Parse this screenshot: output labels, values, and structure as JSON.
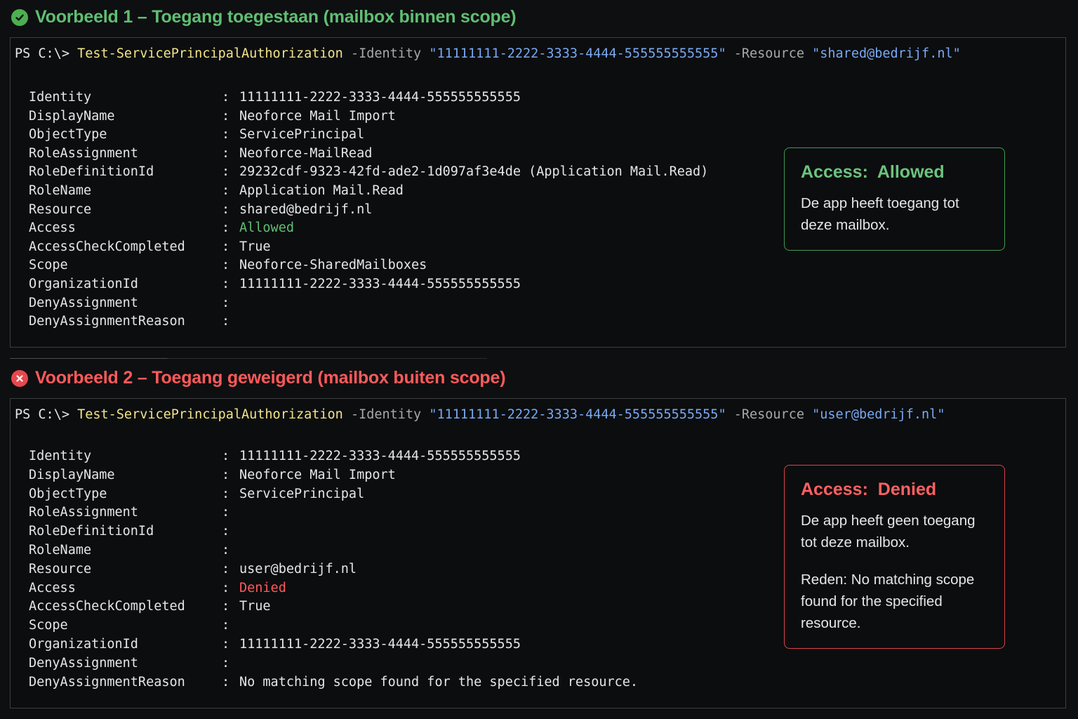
{
  "colors": {
    "success": "#5fbf73",
    "error": "#ff5a5a",
    "cmdlet": "#f1e38a",
    "string": "#79a9f2",
    "background": "#0e0f11"
  },
  "example1": {
    "title": "Voorbeeld 1 – Toegang toegestaan (mailbox binnen scope)",
    "icon": "check-circle-icon",
    "command": {
      "prompt": "PS C:\\>",
      "cmdlet": "Test-ServicePrincipalAuthorization",
      "identity_param": "-Identity",
      "identity_value": "\"11111111-2222-3333-4444-555555555555\"",
      "resource_param": "-Resource",
      "resource_value": "\"shared@bedrijf.nl\""
    },
    "props": [
      {
        "key": "Identity",
        "value": "11111111-2222-3333-4444-555555555555"
      },
      {
        "key": "DisplayName",
        "value": "Neoforce Mail Import"
      },
      {
        "key": "ObjectType",
        "value": "ServicePrincipal"
      },
      {
        "key": "RoleAssignment",
        "value": "Neoforce-MailRead"
      },
      {
        "key": "RoleDefinitionId",
        "value": "29232cdf-9323-42fd-ade2-1d097af3e4de (Application Mail.Read)"
      },
      {
        "key": "RoleName",
        "value": "Application Mail.Read"
      },
      {
        "key": "Resource",
        "value": "shared@bedrijf.nl"
      },
      {
        "key": "Access",
        "value": "Allowed"
      },
      {
        "key": "AccessCheckCompleted",
        "value": "True"
      },
      {
        "key": "Scope",
        "value": "Neoforce-SharedMailboxes"
      },
      {
        "key": "OrganizationId",
        "value": "11111111-2222-3333-4444-555555555555"
      },
      {
        "key": "DenyAssignment",
        "value": ""
      },
      {
        "key": "DenyAssignmentReason",
        "value": ""
      }
    ],
    "callout": {
      "title": "Access:  Allowed",
      "text": "De app heeft toegang tot deze mailbox."
    }
  },
  "example2": {
    "title": "Voorbeeld 2 – Toegang geweigerd (mailbox buiten scope)",
    "icon": "x-circle-icon",
    "command": {
      "prompt": "PS C:\\>",
      "cmdlet": "Test-ServicePrincipalAuthorization",
      "identity_param": "-Identity",
      "identity_value": "\"11111111-2222-3333-4444-555555555555\"",
      "resource_param": "-Resource",
      "resource_value": "\"user@bedrijf.nl\""
    },
    "props": [
      {
        "key": "Identity",
        "value": "11111111-2222-3333-4444-555555555555"
      },
      {
        "key": "DisplayName",
        "value": "Neoforce Mail Import"
      },
      {
        "key": "ObjectType",
        "value": "ServicePrincipal"
      },
      {
        "key": "RoleAssignment",
        "value": ""
      },
      {
        "key": "RoleDefinitionId",
        "value": ""
      },
      {
        "key": "RoleName",
        "value": ""
      },
      {
        "key": "Resource",
        "value": "user@bedrijf.nl"
      },
      {
        "key": "Access",
        "value": "Denied"
      },
      {
        "key": "AccessCheckCompleted",
        "value": "True"
      },
      {
        "key": "Scope",
        "value": ""
      },
      {
        "key": "OrganizationId",
        "value": "11111111-2222-3333-4444-555555555555"
      },
      {
        "key": "DenyAssignment",
        "value": ""
      },
      {
        "key": "DenyAssignmentReason",
        "value": "No matching scope found for the specified resource."
      }
    ],
    "callout": {
      "title": "Access:  Denied",
      "text": "De app heeft geen toegang tot deze mailbox.",
      "reason": "Reden: No matching scope found for the specified resource."
    }
  }
}
